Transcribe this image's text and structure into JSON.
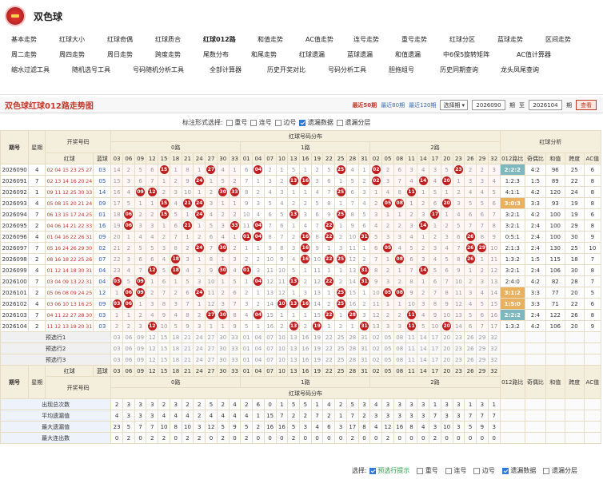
{
  "app": {
    "title": "双色球"
  },
  "nav": {
    "rows": [
      [
        {
          "label": "基本走势",
          "active": false
        },
        {
          "label": "红球大小",
          "active": false
        },
        {
          "label": "红球奇偶",
          "active": false
        },
        {
          "label": "红球质合",
          "active": false
        },
        {
          "label": "红球012路",
          "active": true
        },
        {
          "label": "和值走势",
          "active": false
        },
        {
          "label": "AC值走势",
          "active": false
        },
        {
          "label": "连号走势",
          "active": false
        },
        {
          "label": "重号走势",
          "active": false
        },
        {
          "label": "红球分区",
          "active": false
        },
        {
          "label": "蓝球走势",
          "active": false
        },
        {
          "label": "区间走势",
          "active": false
        }
      ],
      [
        {
          "label": "周二走势",
          "active": false
        },
        {
          "label": "周四走势",
          "active": false
        },
        {
          "label": "周日走势",
          "active": false
        },
        {
          "label": "跨度走势",
          "active": false
        },
        {
          "label": "尾数分布",
          "active": false
        },
        {
          "label": "和尾走势",
          "active": false
        },
        {
          "label": "红球遗漏",
          "active": false
        },
        {
          "label": "蓝球遗漏",
          "active": false
        },
        {
          "label": "和值遗漏",
          "active": false
        },
        {
          "label": "中6保5旋转矩阵",
          "active": false
        },
        {
          "label": "AC值计算器",
          "active": false
        }
      ],
      [
        {
          "label": "缩水过滤工具",
          "active": false
        },
        {
          "label": "随机选号工具",
          "active": false
        },
        {
          "label": "号码随机分析工具",
          "active": false
        },
        {
          "label": "全部计算器",
          "active": false
        },
        {
          "label": "历史开奖对比",
          "active": false
        },
        {
          "label": "号码分析工具",
          "active": false
        },
        {
          "label": "胆拖组号",
          "active": false
        },
        {
          "label": "历史同期查询",
          "active": false
        },
        {
          "label": "龙头凤尾查询",
          "active": false
        }
      ]
    ]
  },
  "toolbar": {
    "title": "双色球红球012路走势图",
    "recent50": "最近50期",
    "recent80": "最近80期",
    "recent120": "最近120期",
    "period_select": "选择期",
    "from": "2026090",
    "from_unit": "期",
    "to_sep": "至",
    "to": "2026104",
    "to_unit": "期",
    "query": "查看"
  },
  "marks": {
    "label": "标注形式选择:",
    "opts": [
      {
        "label": "重号",
        "on": false
      },
      {
        "label": "连号",
        "on": false
      },
      {
        "label": "边号",
        "on": false
      },
      {
        "label": "遗漏数据",
        "on": true
      },
      {
        "label": "遗漏分层",
        "on": false
      }
    ]
  },
  "headers": {
    "period": "期号",
    "week": "星期",
    "draw": "开奖号码",
    "red": "红球",
    "blue": "蓝球",
    "dist": "红球号码分布",
    "g0": "0路",
    "g1": "1路",
    "g2": "2路",
    "analysis": "红球分析",
    "ratio012": "012路比",
    "oddeven": "奇偶比",
    "sum": "和值",
    "span": "跨度",
    "ac": "AC值"
  },
  "cols0": [
    "03",
    "06",
    "09",
    "12",
    "15",
    "18",
    "21",
    "24",
    "27",
    "30",
    "33"
  ],
  "cols1": [
    "01",
    "04",
    "07",
    "10",
    "13",
    "16",
    "19",
    "22",
    "25",
    "28",
    "31"
  ],
  "cols2": [
    "02",
    "05",
    "08",
    "11",
    "14",
    "17",
    "20",
    "23",
    "26",
    "29",
    "32"
  ],
  "rows": [
    {
      "p": "2026090",
      "w": "4",
      "r": "02 04 15 23 25 27",
      "b": "03",
      "c0": [
        "14",
        "2",
        "5",
        "6",
        "15",
        "1",
        "8",
        "1",
        "27",
        "4",
        "1"
      ],
      "c1": [
        "6",
        "04",
        "2",
        "1",
        "5",
        "1",
        "2",
        "5",
        "25",
        "4",
        "1"
      ],
      "c2": [
        "02",
        "2",
        "6",
        "3",
        "4",
        "3",
        "5",
        "23",
        "2",
        "2",
        "3"
      ],
      "a": "2:2:2",
      "ah": 1,
      "oe": "4:2",
      "s": "96",
      "sp": "25",
      "ac": "6"
    },
    {
      "p": "2026091",
      "w": "7",
      "r": "02 13 14 16 20 24",
      "b": "05",
      "c0": [
        "15",
        "3",
        "6",
        "7",
        "1",
        "2",
        "9",
        "24",
        "1",
        "5",
        "2"
      ],
      "c1": [
        "7",
        "1",
        "3",
        "2",
        "13",
        "16",
        "3",
        "6",
        "1",
        "5",
        "2"
      ],
      "c2": [
        "02",
        "3",
        "7",
        "4",
        "14",
        "4",
        "20",
        "1",
        "3",
        "3",
        "4"
      ],
      "a": "1:2:3",
      "ah": 0,
      "oe": "1:5",
      "s": "89",
      "sp": "22",
      "ac": "8"
    },
    {
      "p": "2026092",
      "w": "1",
      "r": "09 11 12 25 30 33",
      "b": "14",
      "c0": [
        "16",
        "4",
        "09",
        "12",
        "2",
        "3",
        "10",
        "1",
        "2",
        "30",
        "33"
      ],
      "c1": [
        "8",
        "2",
        "4",
        "3",
        "1",
        "1",
        "4",
        "7",
        "25",
        "6",
        "3"
      ],
      "c2": [
        "1",
        "4",
        "8",
        "11",
        "1",
        "5",
        "1",
        "2",
        "4",
        "4",
        "5"
      ],
      "a": "4:1:1",
      "ah": 0,
      "oe": "4:2",
      "s": "120",
      "sp": "24",
      "ac": "8"
    },
    {
      "p": "2026093",
      "w": "4",
      "r": "05 08 15 20 21 24",
      "b": "09",
      "c0": [
        "17",
        "5",
        "1",
        "1",
        "15",
        "4",
        "21",
        "24",
        "3",
        "1",
        "1"
      ],
      "c1": [
        "9",
        "3",
        "5",
        "4",
        "2",
        "2",
        "5",
        "8",
        "1",
        "7",
        "4"
      ],
      "c2": [
        "2",
        "05",
        "08",
        "1",
        "2",
        "6",
        "20",
        "3",
        "5",
        "5",
        "6"
      ],
      "a": "3:0:3",
      "ah": 2,
      "oe": "3:3",
      "s": "93",
      "sp": "19",
      "ac": "8"
    },
    {
      "p": "2026094",
      "w": "7",
      "r": "06 13 15 17 24 25",
      "b": "01",
      "c0": [
        "18",
        "06",
        "2",
        "2",
        "15",
        "5",
        "1",
        "24",
        "4",
        "2",
        "2"
      ],
      "c1": [
        "10",
        "4",
        "6",
        "5",
        "13",
        "3",
        "6",
        "9",
        "25",
        "8",
        "5"
      ],
      "c2": [
        "3",
        "1",
        "1",
        "2",
        "3",
        "17",
        "1",
        "4",
        "6",
        "6",
        "7"
      ],
      "a": "3:2:1",
      "ah": 0,
      "oe": "4:2",
      "s": "100",
      "sp": "19",
      "ac": "6"
    },
    {
      "p": "2026095",
      "w": "2",
      "r": "04 06 14 21 22 33",
      "b": "16",
      "c0": [
        "19",
        "06",
        "3",
        "3",
        "1",
        "6",
        "21",
        "1",
        "5",
        "3",
        "33"
      ],
      "c1": [
        "11",
        "04",
        "7",
        "6",
        "1",
        "4",
        "7",
        "22",
        "1",
        "9",
        "6"
      ],
      "c2": [
        "4",
        "2",
        "2",
        "3",
        "14",
        "1",
        "2",
        "5",
        "7",
        "7",
        "8"
      ],
      "a": "3:2:1",
      "ah": 0,
      "oe": "2:4",
      "s": "100",
      "sp": "29",
      "ac": "8"
    },
    {
      "p": "2026096",
      "w": "4",
      "r": "01 04 16 22 26 31",
      "b": "09",
      "c0": [
        "20",
        "1",
        "4",
        "4",
        "2",
        "7",
        "1",
        "2",
        "6",
        "4",
        "1"
      ],
      "c1": [
        "01",
        "04",
        "8",
        "7",
        "2",
        "16",
        "8",
        "22",
        "2",
        "10",
        "31"
      ],
      "c2": [
        "5",
        "3",
        "3",
        "4",
        "1",
        "2",
        "3",
        "6",
        "26",
        "8",
        "9"
      ],
      "a": "0:5:1",
      "ah": 0,
      "oe": "2:4",
      "s": "100",
      "sp": "30",
      "ac": "9"
    },
    {
      "p": "2026097",
      "w": "7",
      "r": "05 16 24 26 29 30",
      "b": "02",
      "c0": [
        "21",
        "2",
        "5",
        "5",
        "3",
        "8",
        "2",
        "24",
        "7",
        "30",
        "2"
      ],
      "c1": [
        "1",
        "1",
        "9",
        "8",
        "3",
        "16",
        "9",
        "1",
        "3",
        "11",
        "1"
      ],
      "c2": [
        "6",
        "05",
        "4",
        "5",
        "2",
        "3",
        "4",
        "7",
        "26",
        "29",
        "10"
      ],
      "a": "2:1:3",
      "ah": 0,
      "oe": "2:4",
      "s": "130",
      "sp": "25",
      "ac": "10"
    },
    {
      "p": "2026098",
      "w": "2",
      "r": "08 16 18 22 25 26",
      "b": "07",
      "c0": [
        "22",
        "3",
        "6",
        "6",
        "4",
        "18",
        "3",
        "1",
        "8",
        "1",
        "3"
      ],
      "c1": [
        "2",
        "2",
        "10",
        "9",
        "4",
        "16",
        "10",
        "22",
        "25",
        "12",
        "2"
      ],
      "c2": [
        "7",
        "1",
        "08",
        "6",
        "3",
        "4",
        "5",
        "8",
        "26",
        "1",
        "11"
      ],
      "a": "1:3:2",
      "ah": 0,
      "oe": "1:5",
      "s": "115",
      "sp": "18",
      "ac": "7"
    },
    {
      "p": "2026099",
      "w": "4",
      "r": "01 12 14 18 30 31",
      "b": "04",
      "c0": [
        "23",
        "4",
        "7",
        "12",
        "5",
        "18",
        "4",
        "2",
        "9",
        "30",
        "4"
      ],
      "c1": [
        "01",
        "3",
        "11",
        "10",
        "5",
        "1",
        "11",
        "1",
        "1",
        "13",
        "31"
      ],
      "c2": [
        "8",
        "2",
        "1",
        "7",
        "14",
        "5",
        "6",
        "9",
        "1",
        "2",
        "12"
      ],
      "a": "3:2:1",
      "ah": 0,
      "oe": "2:4",
      "s": "106",
      "sp": "30",
      "ac": "8"
    },
    {
      "p": "2026100",
      "w": "7",
      "r": "03 04 09 13 22 31",
      "b": "04",
      "c0": [
        "03",
        "5",
        "09",
        "1",
        "6",
        "1",
        "5",
        "3",
        "10",
        "1",
        "5"
      ],
      "c1": [
        "1",
        "04",
        "12",
        "11",
        "13",
        "2",
        "12",
        "22",
        "2",
        "14",
        "31"
      ],
      "c2": [
        "9",
        "3",
        "2",
        "8",
        "1",
        "6",
        "7",
        "10",
        "2",
        "3",
        "13"
      ],
      "a": "2:4:0",
      "ah": 0,
      "oe": "4:2",
      "s": "82",
      "sp": "28",
      "ac": "7"
    },
    {
      "p": "2026101",
      "w": "2",
      "r": "05 06 08 09 24 25",
      "b": "12",
      "c0": [
        "1",
        "06",
        "09",
        "2",
        "7",
        "2",
        "6",
        "24",
        "11",
        "2",
        "6"
      ],
      "c1": [
        "2",
        "1",
        "13",
        "12",
        "1",
        "3",
        "13",
        "1",
        "25",
        "15",
        "1"
      ],
      "c2": [
        "10",
        "05",
        "08",
        "9",
        "2",
        "7",
        "8",
        "11",
        "3",
        "4",
        "14"
      ],
      "a": "3:1:2",
      "ah": 2,
      "oe": "3:3",
      "s": "77",
      "sp": "20",
      "ac": "5"
    },
    {
      "p": "2026102",
      "w": "4",
      "r": "03 06 10 13 16 25",
      "b": "09",
      "c0": [
        "03",
        "06",
        "1",
        "3",
        "8",
        "3",
        "7",
        "1",
        "12",
        "3",
        "7"
      ],
      "c1": [
        "3",
        "2",
        "14",
        "10",
        "13",
        "16",
        "14",
        "2",
        "25",
        "16",
        "2"
      ],
      "c2": [
        "11",
        "1",
        "1",
        "10",
        "3",
        "8",
        "9",
        "12",
        "4",
        "5",
        "15"
      ],
      "a": "1:5:0",
      "ah": 2,
      "oe": "3:3",
      "s": "71",
      "sp": "22",
      "ac": "6"
    },
    {
      "p": "2026103",
      "w": "7",
      "r": "04 11 22 27 28 30",
      "b": "03",
      "c0": [
        "1",
        "1",
        "2",
        "4",
        "9",
        "4",
        "8",
        "2",
        "27",
        "30",
        "8"
      ],
      "c1": [
        "4",
        "04",
        "15",
        "1",
        "1",
        "1",
        "15",
        "22",
        "1",
        "28",
        "3"
      ],
      "c2": [
        "12",
        "2",
        "2",
        "11",
        "4",
        "9",
        "10",
        "13",
        "5",
        "6",
        "16"
      ],
      "a": "2:2:2",
      "ah": 1,
      "oe": "2:4",
      "s": "122",
      "sp": "26",
      "ac": "8"
    },
    {
      "p": "2026104",
      "w": "2",
      "r": "11 12 13 19 20 31",
      "b": "03",
      "c0": [
        "2",
        "2",
        "3",
        "12",
        "10",
        "5",
        "9",
        "3",
        "1",
        "1",
        "9"
      ],
      "c1": [
        "5",
        "1",
        "16",
        "2",
        "13",
        "2",
        "19",
        "1",
        "2",
        "1",
        "31"
      ],
      "c2": [
        "13",
        "3",
        "3",
        "11",
        "5",
        "10",
        "20",
        "14",
        "6",
        "7",
        "17"
      ],
      "a": "1:3:2",
      "ah": 0,
      "oe": "4:2",
      "s": "106",
      "sp": "20",
      "ac": "9"
    }
  ],
  "preselect": [
    {
      "label": "预选行1"
    },
    {
      "label": "预选行2"
    },
    {
      "label": "预选行3"
    }
  ],
  "stats": [
    {
      "label": "出现总次数",
      "vals": [
        "2",
        "3",
        "3",
        "3",
        "2",
        "3",
        "2",
        "2",
        "5",
        "2",
        "4",
        "2",
        "6",
        "0",
        "1",
        "5",
        "5",
        "1",
        "4",
        "2",
        "5",
        "3",
        "4",
        "3",
        "3",
        "3",
        "3",
        "1",
        "3",
        "3",
        "1",
        "3",
        "1",
        "0"
      ]
    },
    {
      "label": "平均遗漏值",
      "vals": [
        "4",
        "3",
        "3",
        "3",
        "4",
        "4",
        "4",
        "2",
        "4",
        "4",
        "4",
        "4",
        "1",
        "15",
        "7",
        "2",
        "2",
        "7",
        "2",
        "1",
        "7",
        "2",
        "3",
        "3",
        "3",
        "3",
        "3",
        "7",
        "3",
        "3",
        "7",
        "7",
        "7",
        "15"
      ]
    },
    {
      "label": "最大遗漏值",
      "vals": [
        "23",
        "5",
        "7",
        "7",
        "10",
        "8",
        "10",
        "3",
        "12",
        "5",
        "9",
        "5",
        "2",
        "16",
        "16",
        "5",
        "3",
        "4",
        "6",
        "3",
        "17",
        "8",
        "4",
        "12",
        "16",
        "8",
        "4",
        "3",
        "10",
        "3",
        "5",
        "9",
        "3",
        "8"
      ]
    },
    {
      "label": "最大连出数",
      "vals": [
        "0",
        "2",
        "0",
        "2",
        "2",
        "0",
        "2",
        "2",
        "0",
        "2",
        "0",
        "2",
        "0",
        "0",
        "0",
        "2",
        "0",
        "0",
        "0",
        "0",
        "2",
        "0",
        "0",
        "2",
        "0",
        "0",
        "0",
        "2",
        "0",
        "0",
        "0",
        "0",
        "0",
        "0"
      ]
    }
  ],
  "bottomopts": {
    "label": "选择:",
    "opts": [
      {
        "label": "预选行提示",
        "on": true,
        "green": true
      },
      {
        "label": "重号",
        "on": false
      },
      {
        "label": "连号",
        "on": false
      },
      {
        "label": "边号",
        "on": false
      },
      {
        "label": "遗漏数据",
        "on": true
      },
      {
        "label": "遗漏分层",
        "on": false
      }
    ]
  }
}
